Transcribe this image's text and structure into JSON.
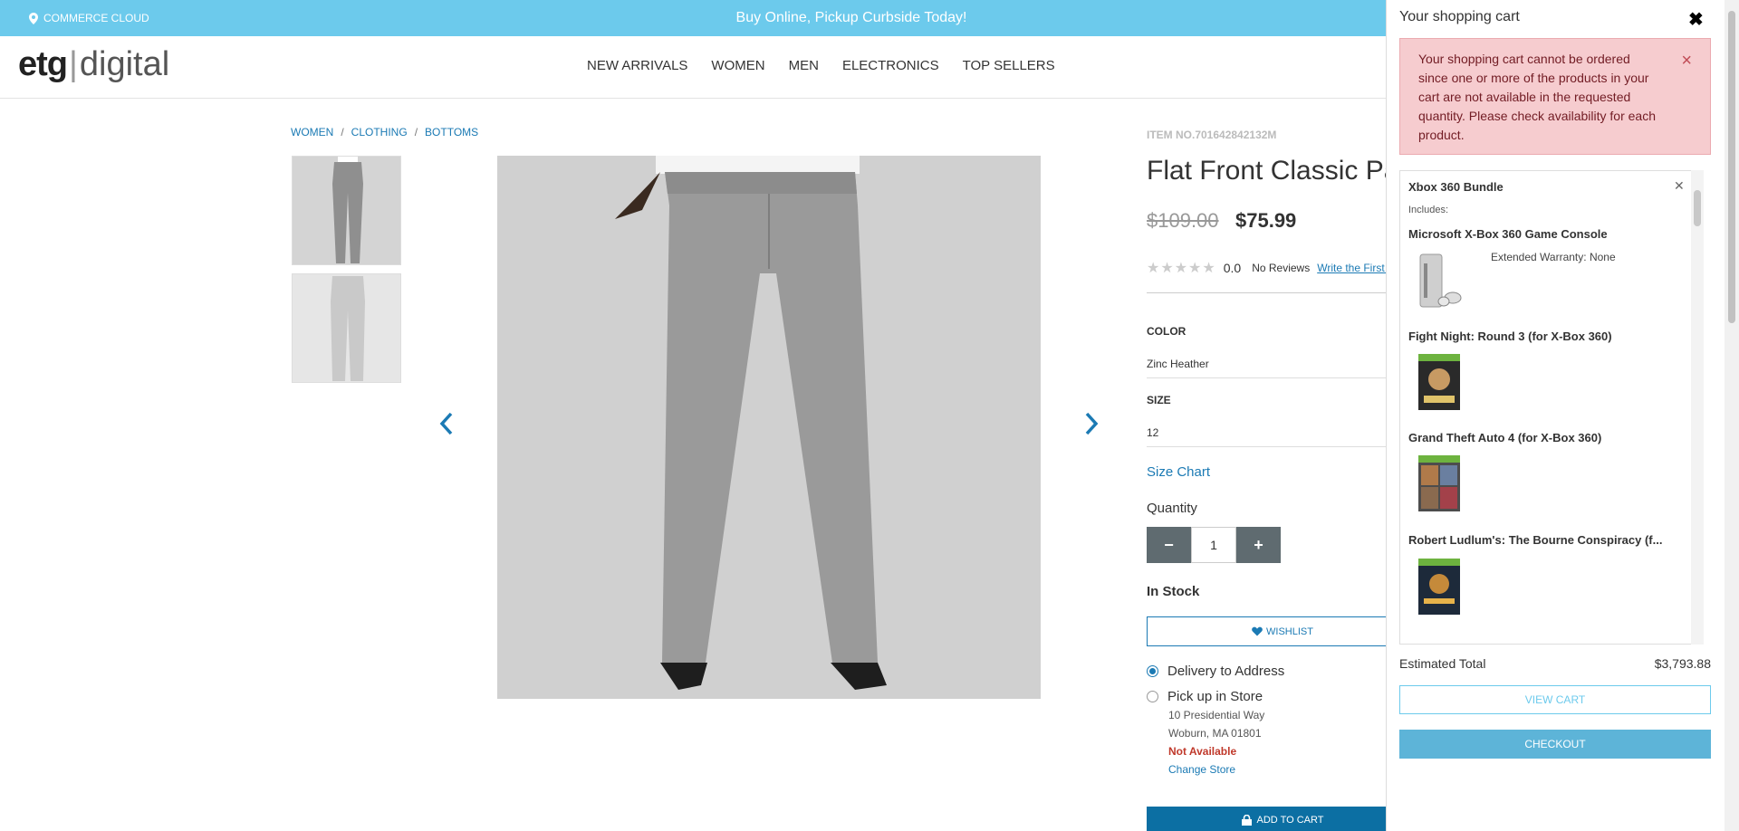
{
  "banner": {
    "location": "COMMERCE CLOUD",
    "promo": "Buy Online, Pickup Curbside Today!"
  },
  "logo": {
    "brand": "etg",
    "sep": "|",
    "suffix": "digital"
  },
  "nav": [
    "NEW ARRIVALS",
    "WOMEN",
    "MEN",
    "ELECTRONICS",
    "TOP SELLERS"
  ],
  "breadcrumb": [
    "WOMEN",
    "CLOTHING",
    "BOTTOMS"
  ],
  "product": {
    "item_no": "ITEM NO.701642842132M",
    "title": "Flat Front Classic Pants",
    "old_price": "$109.00",
    "price": "$75.99",
    "rating": "0.0",
    "reviews": "No Reviews",
    "write_review": "Write the First Review",
    "color_label": "COLOR",
    "color_value": "Zinc Heather",
    "size_label": "SIZE",
    "size_value": "12",
    "size_chart": "Size Chart",
    "quantity_label": "Quantity",
    "quantity": "1",
    "minus": "−",
    "plus": "+",
    "stock": "In Stock",
    "wishlist": "WISHLIST",
    "delivery": "Delivery to Address",
    "pickup": "Pick up in Store",
    "store_address1": "10 Presidential Way",
    "store_address2": "Woburn, MA 01801",
    "store_status": "Not Available",
    "change_store": "Change Store",
    "add_to_cart": "ADD TO CART"
  },
  "cart": {
    "title": "Your shopping cart",
    "alert": "Your shopping cart cannot be ordered since one or more of the products in your cart are not available in the requested quantity. Please check availability for each product.",
    "bundle_title": "Xbox 360 Bundle",
    "includes": "Includes:",
    "items": [
      {
        "name": "Microsoft X-Box 360 Game Console",
        "detail": "Extended Warranty: None"
      },
      {
        "name": "Fight Night: Round 3 (for X-Box 360)"
      },
      {
        "name": "Grand Theft Auto 4 (for X-Box 360)"
      },
      {
        "name": "Robert Ludlum's: The Bourne Conspiracy (f..."
      }
    ],
    "estimated_label": "Estimated Total",
    "estimated_value": "$3,793.88",
    "view_cart": "VIEW CART",
    "checkout": "CHECKOUT"
  },
  "colors": {
    "banner": "#6ccaec",
    "link": "#1b7ab4",
    "alert_bg": "#f6cccf",
    "unavailable": "#c0392b"
  }
}
